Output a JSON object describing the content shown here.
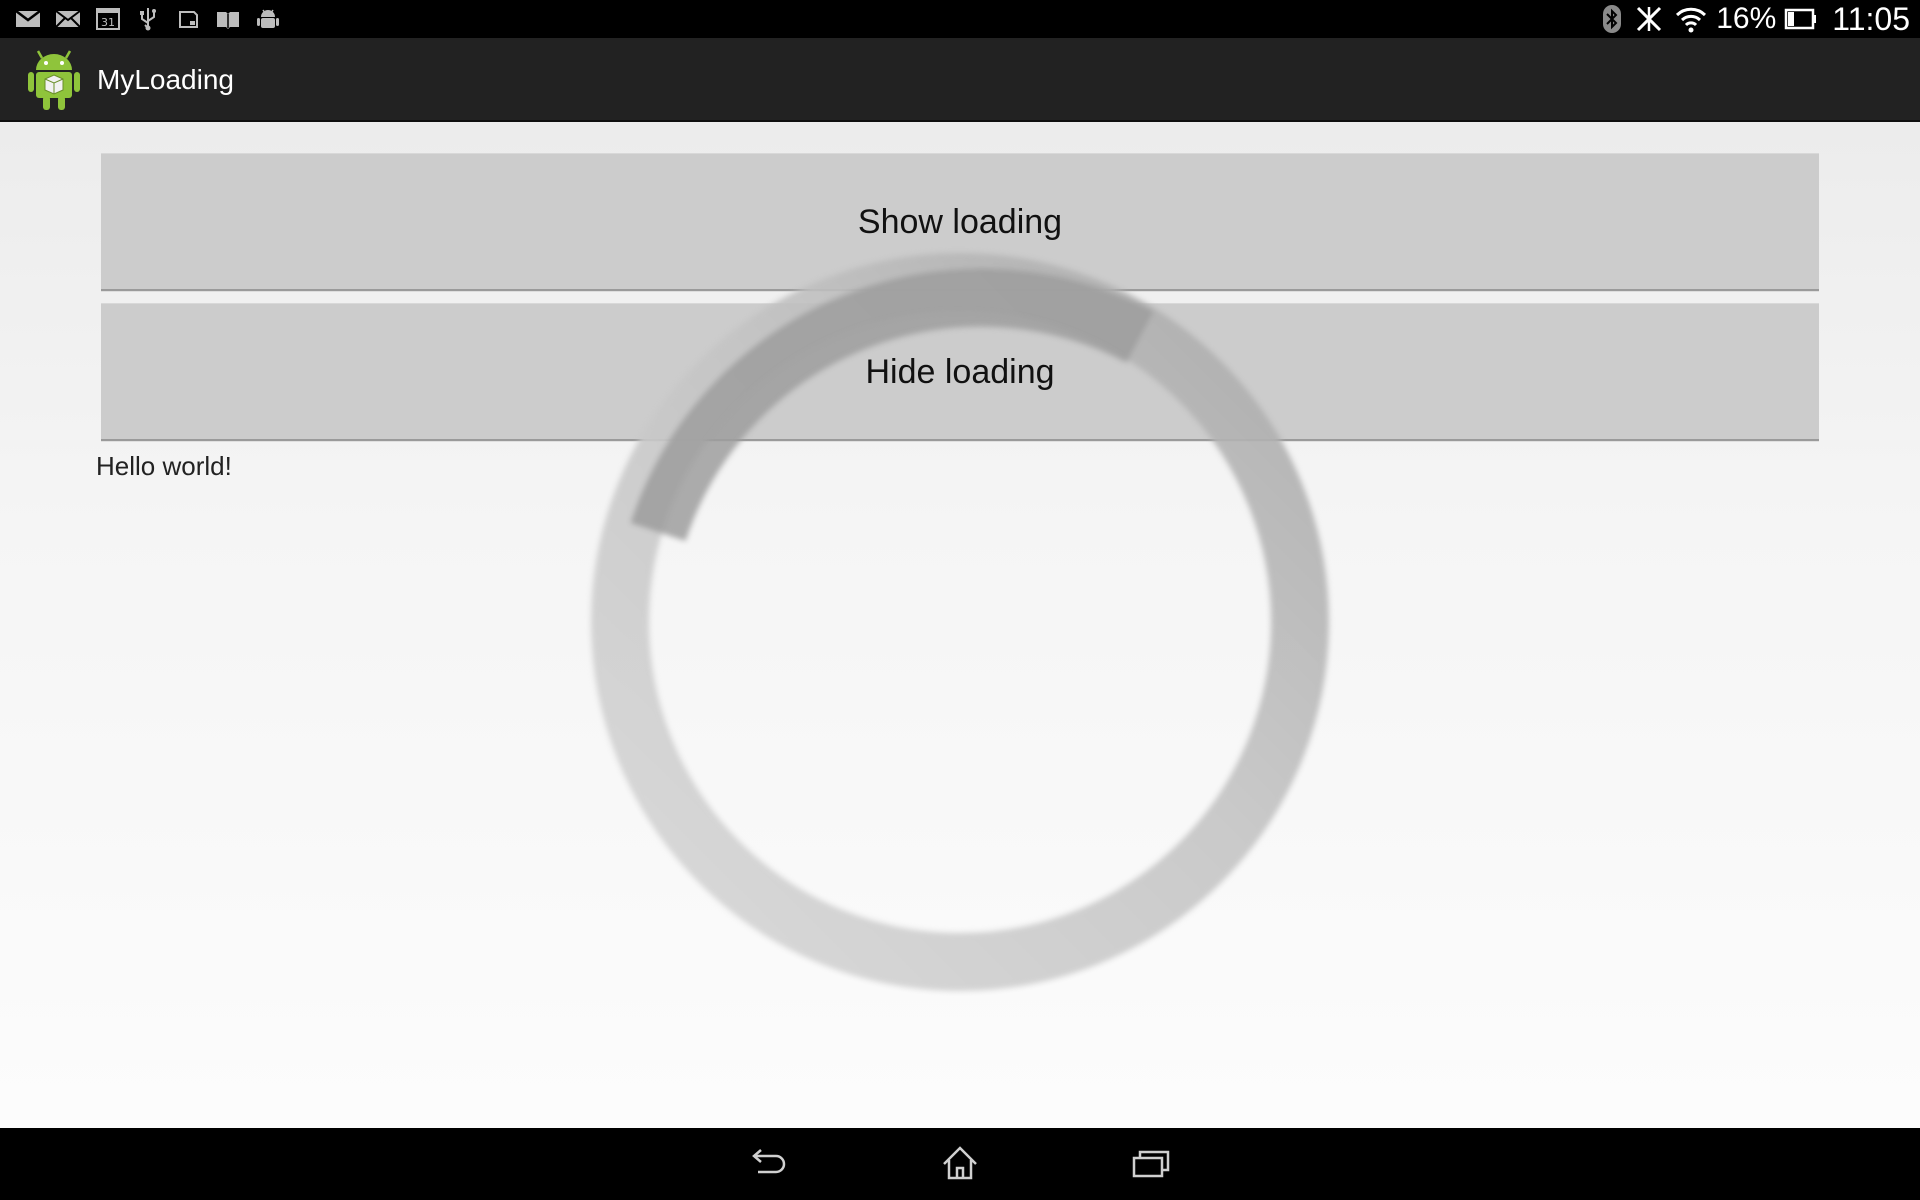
{
  "status_bar": {
    "notification_icons": [
      "gmail-icon",
      "email-icon",
      "calendar-icon",
      "usb-icon",
      "sd-card-icon",
      "book-icon",
      "android-debug-icon"
    ],
    "calendar_day": "31",
    "battery_percent": "16%",
    "battery_level": 0.16,
    "time": "11:05"
  },
  "action_bar": {
    "title": "MyLoading",
    "icon": "android-app-icon"
  },
  "main": {
    "show_button_label": "Show loading",
    "hide_button_label": "Hide loading",
    "hello_text": "Hello world!"
  },
  "spinner": {
    "icon": "loading-spinner",
    "state": "spinning"
  },
  "nav_bar": {
    "icons": [
      "back-icon",
      "home-icon",
      "recent-apps-icon"
    ]
  }
}
